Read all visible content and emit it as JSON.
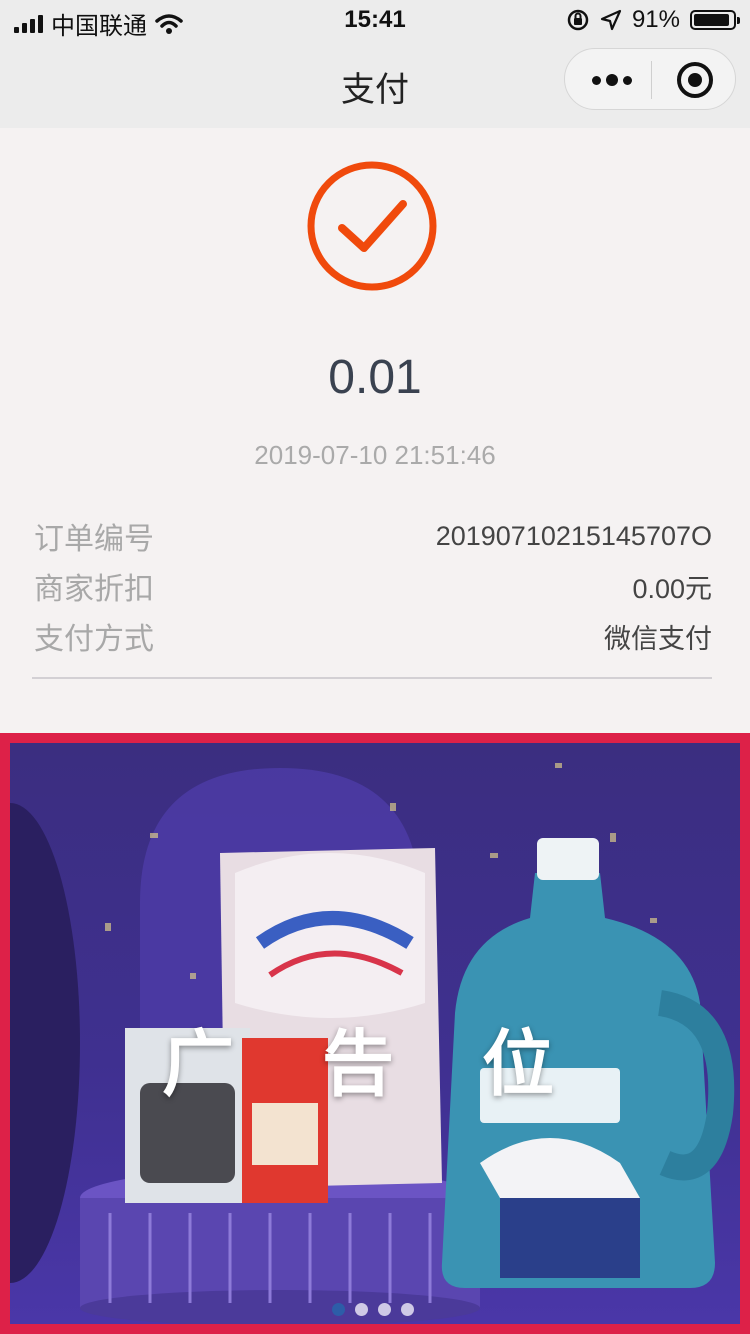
{
  "status_bar": {
    "carrier": "中国联通",
    "time": "15:41",
    "battery_text": "91%",
    "battery_level": 0.91
  },
  "nav": {
    "title": "支付"
  },
  "result": {
    "amount": "0.01",
    "time": "2019-07-10 21:51:46",
    "success_color": "#f04a0c"
  },
  "details": [
    {
      "label": "订单编号",
      "value": "20190710215145707O"
    },
    {
      "label": "商家折扣",
      "value": "0.00元"
    },
    {
      "label": "支付方式",
      "value": "微信支付"
    }
  ],
  "ad": {
    "text": "广 告 位",
    "frame_color": "#dd2148",
    "slide_count": 4,
    "active_slide": 1
  }
}
